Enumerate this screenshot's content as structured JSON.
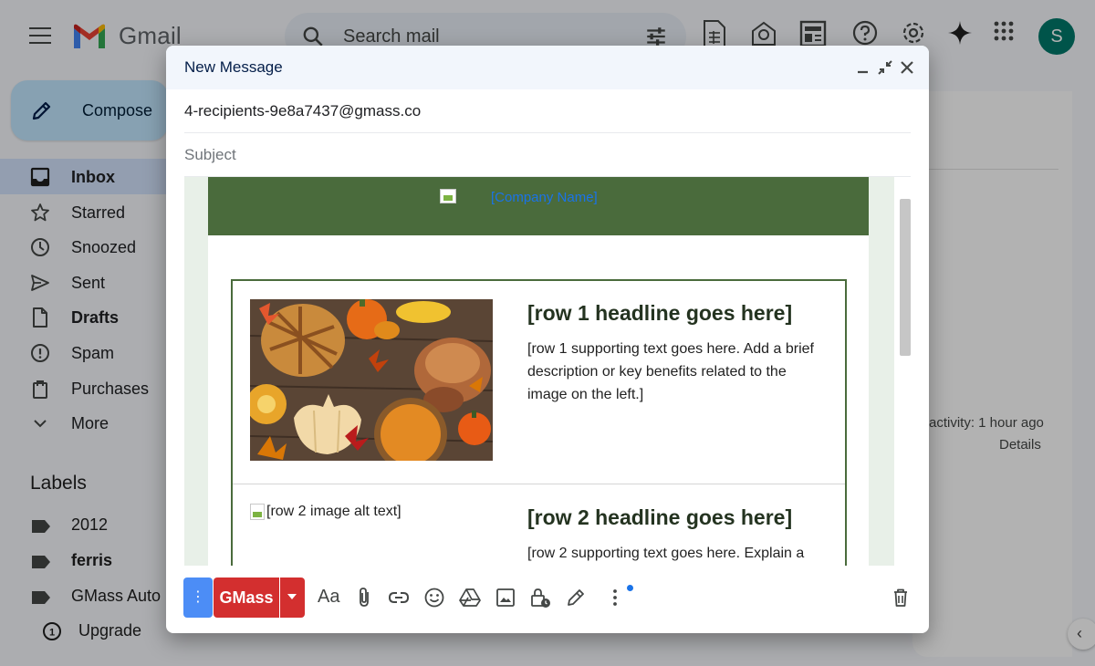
{
  "app": {
    "name": "Gmail"
  },
  "search": {
    "placeholder": "Search mail"
  },
  "account": {
    "avatar_letter": "S"
  },
  "sidebar": {
    "compose_label": "Compose",
    "items": [
      {
        "label": "Inbox",
        "icon": "inbox-icon",
        "active": true,
        "bold": true
      },
      {
        "label": "Starred",
        "icon": "star-icon"
      },
      {
        "label": "Snoozed",
        "icon": "clock-icon"
      },
      {
        "label": "Sent",
        "icon": "send-icon"
      },
      {
        "label": "Drafts",
        "icon": "draft-icon",
        "bold": true
      },
      {
        "label": "Spam",
        "icon": "spam-icon"
      },
      {
        "label": "Purchases",
        "icon": "purchases-icon"
      },
      {
        "label": "More",
        "icon": "chevron-down-icon"
      }
    ],
    "labels_heading": "Labels",
    "labels": [
      {
        "label": "2012"
      },
      {
        "label": "ferris",
        "bold": true
      },
      {
        "label": "GMass Auto F"
      }
    ],
    "upgrade_label": "Upgrade"
  },
  "main": {
    "activity": "activity: 1 hour ago",
    "details": "Details"
  },
  "compose": {
    "title": "New Message",
    "to": "4-recipients-9e8a7437@gmass.co",
    "subject_placeholder": "Subject",
    "email": {
      "company_name": "[Company Name]",
      "row1_headline": "[row 1 headline goes here]",
      "row1_text": "[row 1 supporting text goes here. Add a brief description or key benefits related to the image on the left.]",
      "row2_image_alt": "[row 2 image alt text]",
      "row2_headline": "[row 2 headline goes here]",
      "row2_text": "[row 2 supporting text goes here. Explain a"
    },
    "toolbar": {
      "gmass_label": "GMass",
      "more_dots": "⋮",
      "format_label": "Aa"
    }
  },
  "colors": {
    "banner_green": "#4a6b3c",
    "gmass_red": "#d32f2f",
    "options_blue": "#4c8df6",
    "link_blue": "#1a73e8"
  }
}
